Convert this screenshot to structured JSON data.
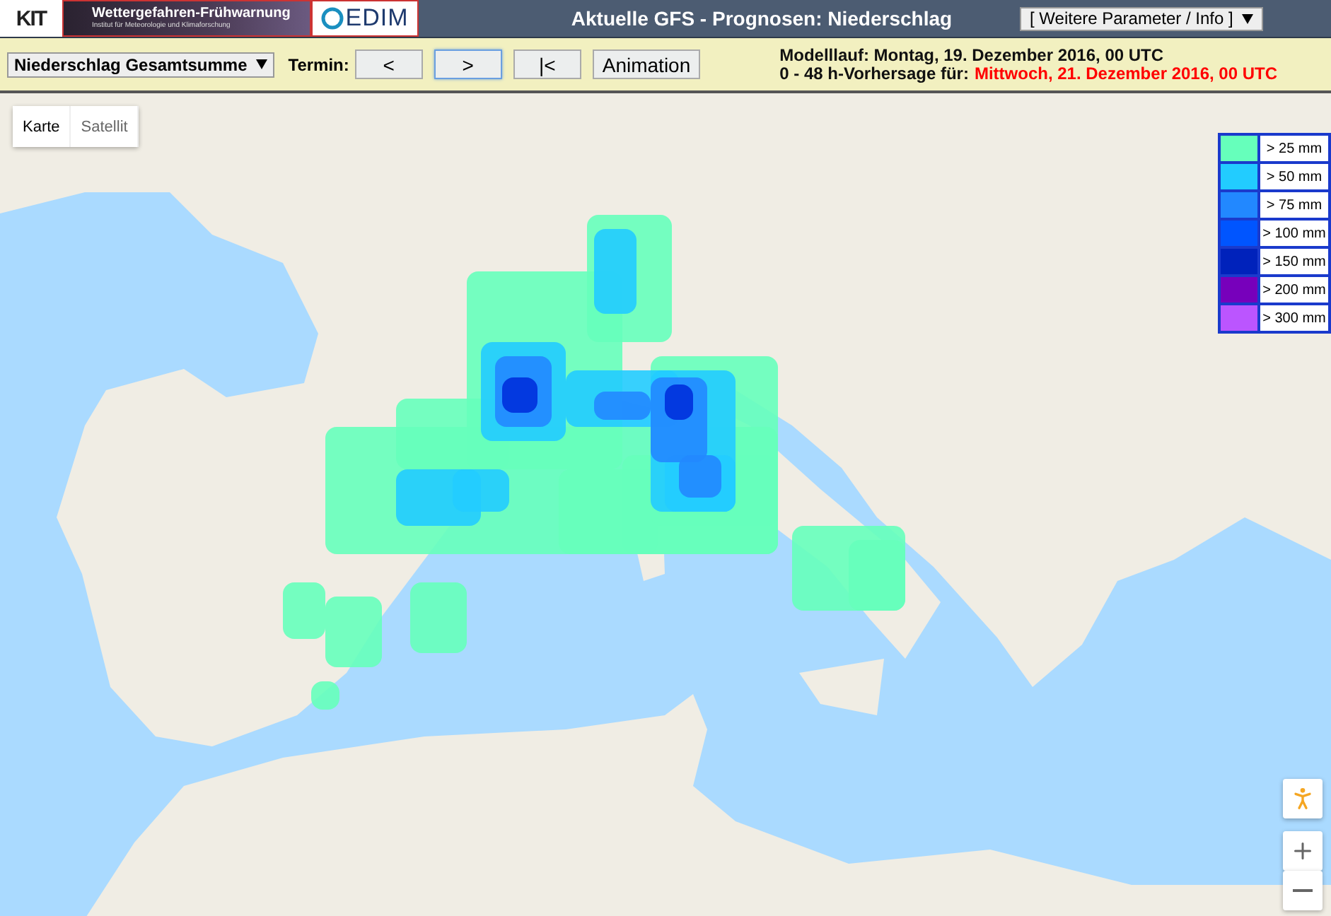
{
  "header": {
    "logos": {
      "kit": "KIT",
      "banner_title": "Wettergefahren-Frühwarnung",
      "banner_subtitle": "Institut für Meteorologie und Klimaforschung",
      "cedim": "EDIM"
    },
    "title": "Aktuelle GFS - Prognosen: Niederschlag",
    "menu": "[ Weitere Parameter / Info ]"
  },
  "toolbar": {
    "parameter_select": "Niederschlag Gesamtsumme",
    "termin_label": "Termin:",
    "buttons": [
      {
        "label": "<",
        "selected": false
      },
      {
        "label": ">",
        "selected": true
      },
      {
        "label": "|<",
        "selected": false
      },
      {
        "label": "Animation",
        "selected": false
      }
    ],
    "model_run": "Modelllauf: Montag, 19. Dezember 2016, 00 UTC",
    "forecast_label": "0 - 48 h-Vorhersage für:",
    "forecast_date": "Mittwoch, 21. Dezember 2016, 00 UTC"
  },
  "map": {
    "map_types": [
      {
        "label": "Karte",
        "selected": true
      },
      {
        "label": "Satellit",
        "selected": false
      }
    ],
    "legend": [
      {
        "label": "> 25 mm",
        "color": "#66ffbb"
      },
      {
        "label": "> 50 mm",
        "color": "#22ccff"
      },
      {
        "label": "> 75 mm",
        "color": "#2288ff"
      },
      {
        "label": "> 100 mm",
        "color": "#0055ff"
      },
      {
        "label": "> 150 mm",
        "color": "#0022bb"
      },
      {
        "label": "> 200 mm",
        "color": "#7700bb"
      },
      {
        "label": "> 300 mm",
        "color": "#bb55ff"
      }
    ]
  }
}
